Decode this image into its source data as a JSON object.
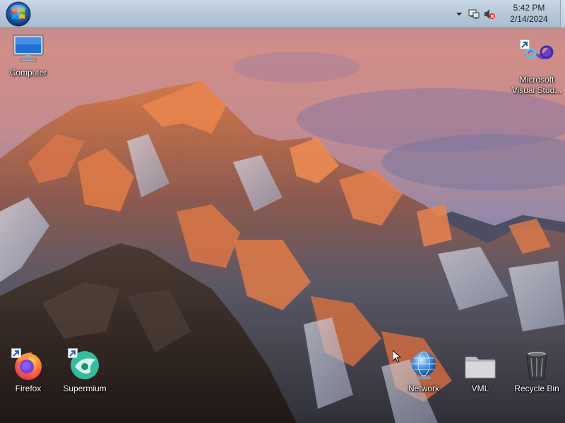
{
  "taskbar": {
    "start_icon": "windows-orb-icon",
    "tray": {
      "chevron_icon": "chevron-up-icon",
      "network_icon": "network-status-icon",
      "volume_icon": "volume-muted-icon",
      "time": "5:42 PM",
      "date": "2/14/2024"
    }
  },
  "desktop": {
    "wallpaper": "mountain-sunset",
    "icons": {
      "computer": {
        "label": "Computer",
        "icon": "computer-monitor-icon"
      },
      "visual_studio": {
        "label": "Microsoft Visual Stud...",
        "icon": "visual-studio-icon",
        "shortcut": true
      },
      "firefox": {
        "label": "Firefox",
        "icon": "firefox-icon",
        "shortcut": true
      },
      "supermium": {
        "label": "Supermium",
        "icon": "supermium-icon",
        "shortcut": true
      },
      "network": {
        "label": "Network",
        "icon": "network-globe-icon"
      },
      "vml": {
        "label": "VML",
        "icon": "folder-icon"
      },
      "recycle_bin": {
        "label": "Recycle Bin",
        "icon": "recycle-bin-icon"
      }
    }
  },
  "colors": {
    "sky_top": "#c98a8a",
    "sky_purple": "#8c7fa3",
    "peak_orange": "#e07a4a",
    "rock_dark": "#3b2e2a",
    "taskbar": "#b5c8da"
  }
}
